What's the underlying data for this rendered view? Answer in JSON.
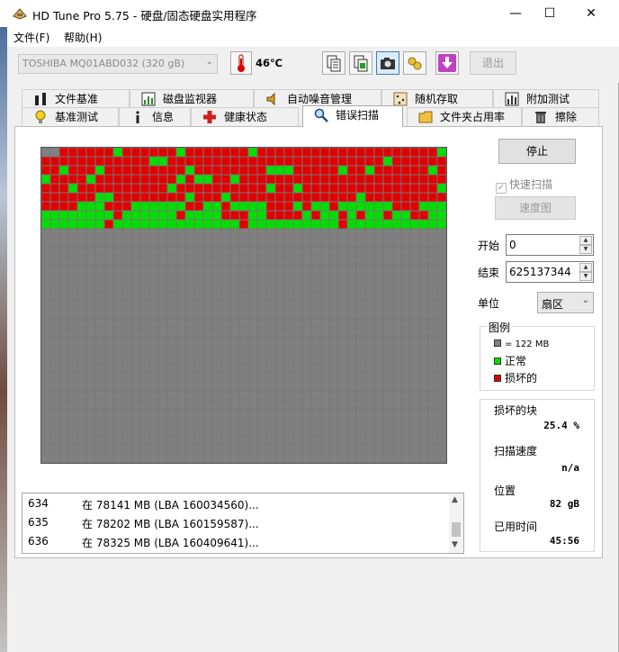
{
  "window": {
    "title": "HD Tune Pro 5.75 - 硬盘/固态硬盘实用程序",
    "minimize": "—",
    "maximize": "☐",
    "close": "✕"
  },
  "menu": [
    "文件(F)",
    "帮助(H)"
  ],
  "toolbar": {
    "drive": "TOSHIBA MQ01ABD032 (320 gB)",
    "temperature": "46℃",
    "exit_label": "退出",
    "buttons": [
      "copy-text-icon",
      "copy-info-icon",
      "screenshot-camera-icon",
      "options-icon",
      "download-icon"
    ]
  },
  "tabs": {
    "row1": [
      "文件基准",
      "磁盘监视器",
      "自动噪音管理",
      "随机存取",
      "附加测试"
    ],
    "row2": [
      "基准测试",
      "信息",
      "健康状态",
      "错误扫描",
      "文件夹占用率",
      "擦除"
    ],
    "active": "错误扫描"
  },
  "scan_grid": {
    "columns": 45,
    "rows": 35,
    "damaged_fraction": 0.254,
    "colors": {
      "untested": "#808080",
      "ok": "#00e000",
      "damaged": "#e00000"
    }
  },
  "log": [
    {
      "num": "634",
      "text": "在 78141 MB (LBA 160034560)..."
    },
    {
      "num": "635",
      "text": "在 78202 MB (LBA 160159587)..."
    },
    {
      "num": "636",
      "text": "在 78325 MB (LBA 160409641)..."
    }
  ],
  "controls": {
    "stop_label": "停止",
    "quick_scan_label": "快速扫描",
    "quick_scan_checked": true,
    "speed_map_label": "速度图",
    "start_label": "开始",
    "start_value": "0",
    "end_label": "结束",
    "end_value": "625137344",
    "unit_label": "单位",
    "unit_value": "扇区"
  },
  "legend": {
    "title": "图例",
    "block": "= 122 MB",
    "ok": "正常",
    "damaged": "损坏的"
  },
  "stats": {
    "damaged_label": "损坏的块",
    "damaged_value": "25.4 %",
    "speed_label": "扫描速度",
    "speed_value": "n/a",
    "position_label": "位置",
    "position_value": "82 gB",
    "elapsed_label": "已用时间",
    "elapsed_value": "45:56"
  }
}
